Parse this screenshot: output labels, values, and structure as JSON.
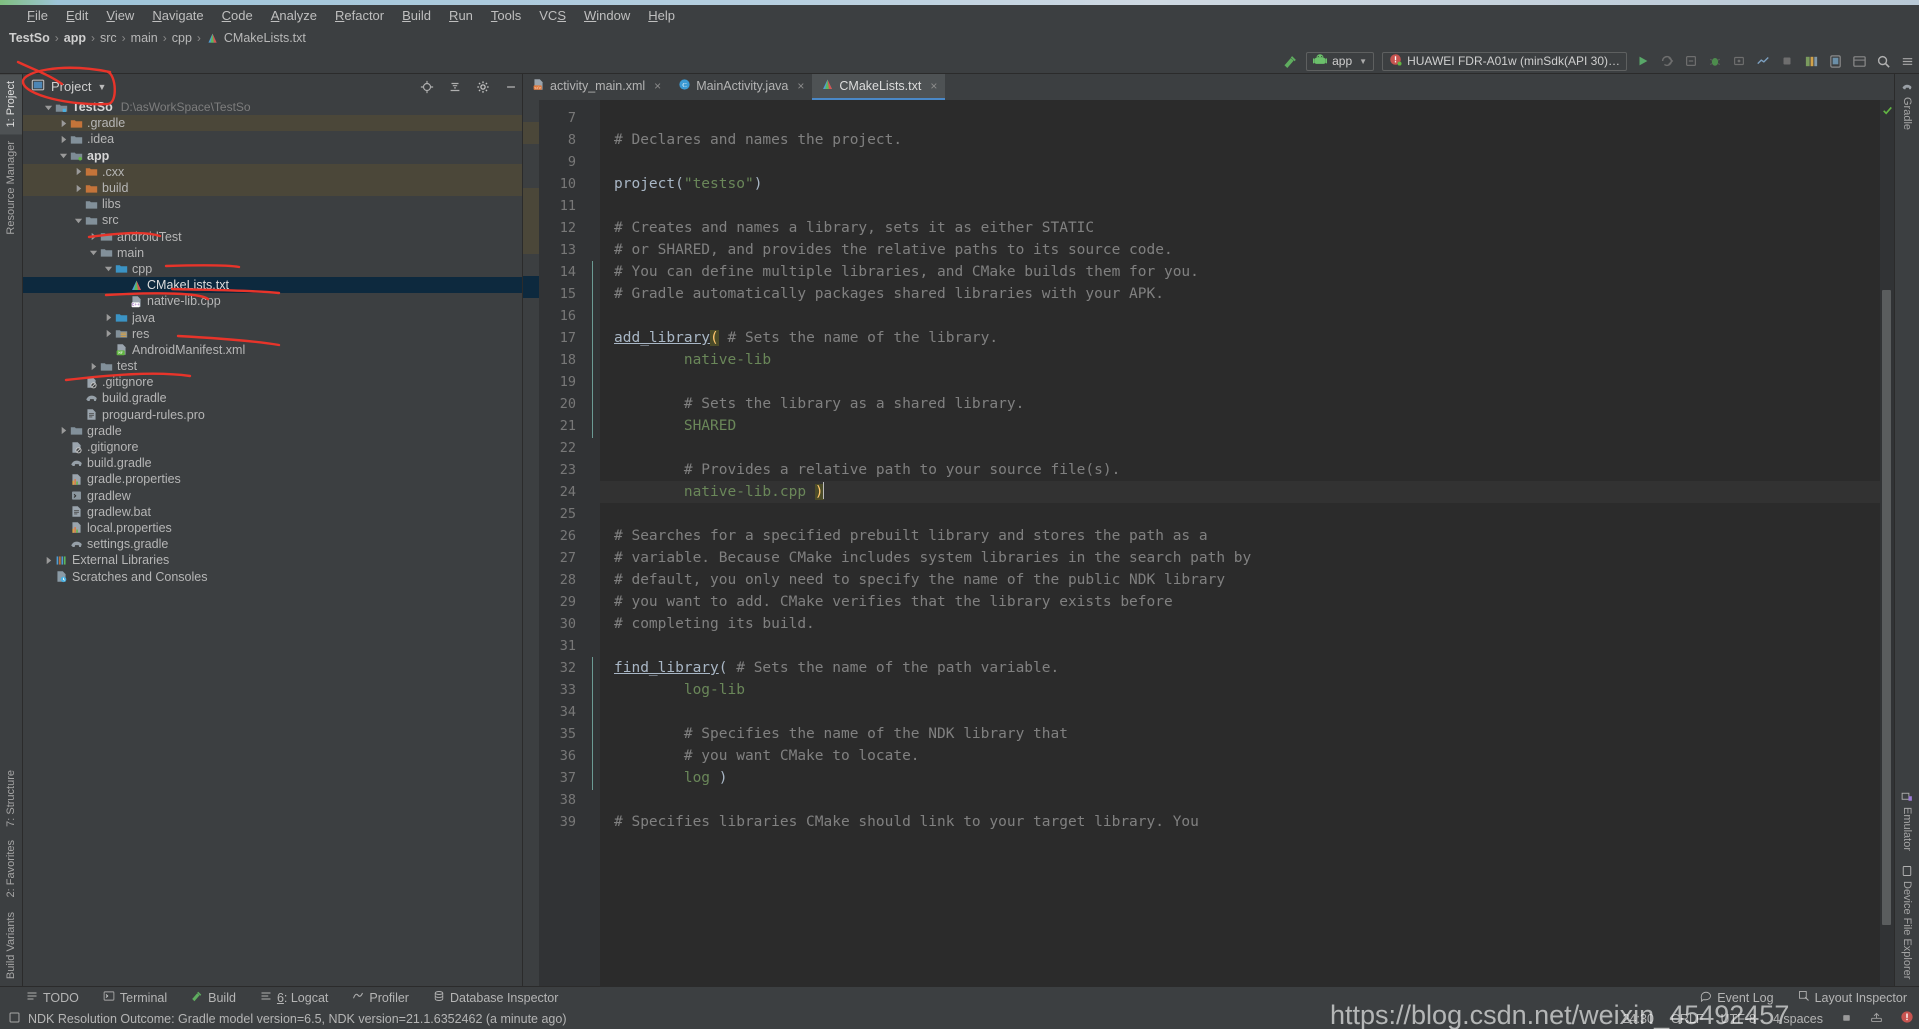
{
  "window": {
    "title": "TestSo"
  },
  "menubar": {
    "items": [
      {
        "label": "File",
        "mnemonic": "F"
      },
      {
        "label": "Edit",
        "mnemonic": "E"
      },
      {
        "label": "View",
        "mnemonic": "V"
      },
      {
        "label": "Navigate",
        "mnemonic": "N"
      },
      {
        "label": "Code",
        "mnemonic": "C"
      },
      {
        "label": "Analyze",
        "mnemonic": "A"
      },
      {
        "label": "Refactor",
        "mnemonic": "R"
      },
      {
        "label": "Build",
        "mnemonic": "B"
      },
      {
        "label": "Run",
        "mnemonic": "R"
      },
      {
        "label": "Tools",
        "mnemonic": "T"
      },
      {
        "label": "VCS",
        "mnemonic": "S"
      },
      {
        "label": "Window",
        "mnemonic": "W"
      },
      {
        "label": "Help",
        "mnemonic": "H"
      }
    ]
  },
  "breadcrumb": {
    "items": [
      "TestSo",
      "app",
      "src",
      "main",
      "cpp",
      "CMakeLists.txt"
    ],
    "separator": "›"
  },
  "toolbar": {
    "module_selector": "app",
    "device_selector": "HUAWEI FDR-A01w (minSdk(API 30)…",
    "run_tooltip": "Run",
    "icons": [
      "build-hammer-icon",
      "module-app-icon",
      "device-icon",
      "run-icon",
      "apply-changes-icon",
      "debug-icon",
      "attach-debugger-icon",
      "profiler-icon",
      "stop-icon",
      "avd-manager-icon",
      "sdk-manager-icon",
      "layout-inspector-icon",
      "search-icon",
      "more-icon"
    ]
  },
  "left_strip": {
    "top_items": [
      "1: Project",
      "Resource Manager"
    ],
    "bottom_items": [
      "7: Structure",
      "2: Favorites",
      "Build Variants"
    ],
    "selected": "1: Project"
  },
  "right_strip": {
    "top_items": [
      "Gradle"
    ],
    "bottom_items": [
      "Emulator",
      "Device File Explorer"
    ]
  },
  "project_panel": {
    "title": "Project",
    "header_icons": [
      "locate-icon",
      "collapse-all-icon",
      "settings-gear-icon",
      "minimize-icon"
    ],
    "tree": [
      {
        "depth": 0,
        "twist": "down",
        "icon": "module-root",
        "label": "TestSo",
        "path": "D:\\asWorkSpace\\TestSo",
        "bold": true,
        "alt": false,
        "selected": false
      },
      {
        "depth": 1,
        "twist": "right",
        "icon": "folder-orange",
        "label": ".gradle",
        "path": "",
        "bold": false,
        "alt": true,
        "selected": false
      },
      {
        "depth": 1,
        "twist": "right",
        "icon": "folder-grey",
        "label": ".idea",
        "path": "",
        "bold": false,
        "alt": false,
        "selected": false
      },
      {
        "depth": 1,
        "twist": "down",
        "icon": "module-app",
        "label": "app",
        "path": "",
        "bold": true,
        "alt": false,
        "selected": false
      },
      {
        "depth": 2,
        "twist": "right",
        "icon": "folder-orange",
        "label": ".cxx",
        "path": "",
        "bold": false,
        "alt": true,
        "selected": false
      },
      {
        "depth": 2,
        "twist": "right",
        "icon": "folder-orange",
        "label": "build",
        "path": "",
        "bold": false,
        "alt": true,
        "selected": false
      },
      {
        "depth": 2,
        "twist": "none",
        "icon": "folder-grey",
        "label": "libs",
        "path": "",
        "bold": false,
        "alt": false,
        "selected": false
      },
      {
        "depth": 2,
        "twist": "down",
        "icon": "folder-grey",
        "label": "src",
        "path": "",
        "bold": false,
        "alt": false,
        "selected": false
      },
      {
        "depth": 3,
        "twist": "right",
        "icon": "folder-grey",
        "label": "androidTest",
        "path": "",
        "bold": false,
        "alt": false,
        "selected": false
      },
      {
        "depth": 3,
        "twist": "down",
        "icon": "folder-grey",
        "label": "main",
        "path": "",
        "bold": false,
        "alt": false,
        "selected": false
      },
      {
        "depth": 4,
        "twist": "down",
        "icon": "folder-blue",
        "label": "cpp",
        "path": "",
        "bold": false,
        "alt": false,
        "selected": false
      },
      {
        "depth": 5,
        "twist": "none",
        "icon": "cmake-file",
        "label": "CMakeLists.txt",
        "path": "",
        "bold": false,
        "alt": false,
        "selected": true
      },
      {
        "depth": 5,
        "twist": "none",
        "icon": "cpp-file",
        "label": "native-lib.cpp",
        "path": "",
        "bold": false,
        "alt": false,
        "selected": false
      },
      {
        "depth": 4,
        "twist": "right",
        "icon": "folder-blue",
        "label": "java",
        "path": "",
        "bold": false,
        "alt": false,
        "selected": false
      },
      {
        "depth": 4,
        "twist": "right",
        "icon": "folder-res",
        "label": "res",
        "path": "",
        "bold": false,
        "alt": false,
        "selected": false
      },
      {
        "depth": 4,
        "twist": "none",
        "icon": "manifest-file",
        "label": "AndroidManifest.xml",
        "path": "",
        "bold": false,
        "alt": false,
        "selected": false
      },
      {
        "depth": 3,
        "twist": "right",
        "icon": "folder-grey",
        "label": "test",
        "path": "",
        "bold": false,
        "alt": false,
        "selected": false
      },
      {
        "depth": 2,
        "twist": "none",
        "icon": "gitignore-file",
        "label": ".gitignore",
        "path": "",
        "bold": false,
        "alt": false,
        "selected": false
      },
      {
        "depth": 2,
        "twist": "none",
        "icon": "gradle-file",
        "label": "build.gradle",
        "path": "",
        "bold": false,
        "alt": false,
        "selected": false
      },
      {
        "depth": 2,
        "twist": "none",
        "icon": "text-file",
        "label": "proguard-rules.pro",
        "path": "",
        "bold": false,
        "alt": false,
        "selected": false
      },
      {
        "depth": 1,
        "twist": "right",
        "icon": "folder-grey",
        "label": "gradle",
        "path": "",
        "bold": false,
        "alt": false,
        "selected": false
      },
      {
        "depth": 1,
        "twist": "none",
        "icon": "gitignore-file",
        "label": ".gitignore",
        "path": "",
        "bold": false,
        "alt": false,
        "selected": false
      },
      {
        "depth": 1,
        "twist": "none",
        "icon": "gradle-file",
        "label": "build.gradle",
        "path": "",
        "bold": false,
        "alt": false,
        "selected": false
      },
      {
        "depth": 1,
        "twist": "none",
        "icon": "properties-file",
        "label": "gradle.properties",
        "path": "",
        "bold": false,
        "alt": false,
        "selected": false
      },
      {
        "depth": 1,
        "twist": "none",
        "icon": "script-file",
        "label": "gradlew",
        "path": "",
        "bold": false,
        "alt": false,
        "selected": false
      },
      {
        "depth": 1,
        "twist": "none",
        "icon": "text-file",
        "label": "gradlew.bat",
        "path": "",
        "bold": false,
        "alt": false,
        "selected": false
      },
      {
        "depth": 1,
        "twist": "none",
        "icon": "properties-file",
        "label": "local.properties",
        "path": "",
        "bold": false,
        "alt": false,
        "selected": false
      },
      {
        "depth": 1,
        "twist": "none",
        "icon": "gradle-file",
        "label": "settings.gradle",
        "path": "",
        "bold": false,
        "alt": false,
        "selected": false
      },
      {
        "depth": 0,
        "twist": "right",
        "icon": "libraries-icon",
        "label": "External Libraries",
        "path": "",
        "bold": false,
        "alt": false,
        "selected": false
      },
      {
        "depth": 0,
        "twist": "none",
        "icon": "scratches-icon",
        "label": "Scratches and Consoles",
        "path": "",
        "bold": false,
        "alt": false,
        "selected": false
      }
    ]
  },
  "editor": {
    "tabs": [
      {
        "label": "activity_main.xml",
        "icon": "xml-layout-icon",
        "active": false,
        "closable": true
      },
      {
        "label": "MainActivity.java",
        "icon": "java-class-icon",
        "active": false,
        "closable": true
      },
      {
        "label": "CMakeLists.txt",
        "icon": "cmake-icon",
        "active": true,
        "closable": true
      }
    ],
    "first_line_number": 7,
    "lines": [
      {
        "n": 7,
        "tokens": []
      },
      {
        "n": 8,
        "tokens": [
          {
            "t": "# Declares and names the project.",
            "c": "cm"
          }
        ]
      },
      {
        "n": 9,
        "tokens": []
      },
      {
        "n": 10,
        "tokens": [
          {
            "t": "project(",
            "c": "par"
          },
          {
            "t": "\"testso\"",
            "c": "str"
          },
          {
            "t": ")",
            "c": "par"
          }
        ]
      },
      {
        "n": 11,
        "tokens": []
      },
      {
        "n": 12,
        "tokens": [
          {
            "t": "# Creates and names a library, sets it as either STATIC",
            "c": "cm"
          }
        ]
      },
      {
        "n": 13,
        "tokens": [
          {
            "t": "# or SHARED, and provides the relative paths to its source code.",
            "c": "cm"
          }
        ]
      },
      {
        "n": 14,
        "tokens": [
          {
            "t": "# You can define multiple libraries, and CMake builds them for you.",
            "c": "cm"
          }
        ]
      },
      {
        "n": 15,
        "tokens": [
          {
            "t": "# Gradle automatically packages shared libraries with your APK.",
            "c": "cm"
          }
        ]
      },
      {
        "n": 16,
        "tokens": []
      },
      {
        "n": 17,
        "tokens": [
          {
            "t": "add_library",
            "c": "kw"
          },
          {
            "t": "(",
            "c": "brk"
          },
          {
            "t": " # Sets the name of the library.",
            "c": "cm"
          }
        ]
      },
      {
        "n": 18,
        "tokens": [
          {
            "t": "        native-lib",
            "c": "grn"
          }
        ]
      },
      {
        "n": 19,
        "tokens": []
      },
      {
        "n": 20,
        "tokens": [
          {
            "t": "        # Sets the library as a shared library.",
            "c": "cm"
          }
        ]
      },
      {
        "n": 21,
        "tokens": [
          {
            "t": "        SHARED",
            "c": "grn"
          }
        ]
      },
      {
        "n": 22,
        "tokens": []
      },
      {
        "n": 23,
        "tokens": [
          {
            "t": "        # Provides a relative path to your source file(s).",
            "c": "cm"
          }
        ]
      },
      {
        "n": 24,
        "tokens": [
          {
            "t": "        native-lib.cpp ",
            "c": "grn"
          },
          {
            "t": ")",
            "c": "brk"
          }
        ],
        "current": true,
        "caret": true
      },
      {
        "n": 25,
        "tokens": []
      },
      {
        "n": 26,
        "tokens": [
          {
            "t": "# Searches for a specified prebuilt library and stores the path as a",
            "c": "cm"
          }
        ]
      },
      {
        "n": 27,
        "tokens": [
          {
            "t": "# variable. Because CMake includes system libraries in the search path by",
            "c": "cm"
          }
        ]
      },
      {
        "n": 28,
        "tokens": [
          {
            "t": "# default, you only need to specify the name of the public NDK library",
            "c": "cm"
          }
        ]
      },
      {
        "n": 29,
        "tokens": [
          {
            "t": "# you want to add. CMake verifies that the library exists before",
            "c": "cm"
          }
        ]
      },
      {
        "n": 30,
        "tokens": [
          {
            "t": "# completing its build.",
            "c": "cm"
          }
        ]
      },
      {
        "n": 31,
        "tokens": []
      },
      {
        "n": 32,
        "tokens": [
          {
            "t": "find_library",
            "c": "kw"
          },
          {
            "t": "(",
            "c": "par"
          },
          {
            "t": " # Sets the name of the path variable.",
            "c": "cm"
          }
        ]
      },
      {
        "n": 33,
        "tokens": [
          {
            "t": "        log-lib",
            "c": "grn"
          }
        ]
      },
      {
        "n": 34,
        "tokens": []
      },
      {
        "n": 35,
        "tokens": [
          {
            "t": "        # Specifies the name of the NDK library that",
            "c": "cm"
          }
        ]
      },
      {
        "n": 36,
        "tokens": [
          {
            "t": "        # you want CMake to locate.",
            "c": "cm"
          }
        ]
      },
      {
        "n": 37,
        "tokens": [
          {
            "t": "        log ",
            "c": "grn"
          },
          {
            "t": ")",
            "c": "par"
          }
        ]
      },
      {
        "n": 38,
        "tokens": []
      },
      {
        "n": 39,
        "tokens": [
          {
            "t": "# Specifies libraries CMake should link to your target library. You",
            "c": "cm"
          }
        ]
      }
    ]
  },
  "bottom_tools": [
    {
      "label": "TODO",
      "icon": "todo-icon",
      "mnemonic": ""
    },
    {
      "label": "Terminal",
      "icon": "terminal-icon",
      "mnemonic": ""
    },
    {
      "label": "Build",
      "icon": "build-hammer-icon",
      "mnemonic": ""
    },
    {
      "label": "6: Logcat",
      "icon": "logcat-icon",
      "mnemonic": "6"
    },
    {
      "label": "Profiler",
      "icon": "profiler-icon",
      "mnemonic": ""
    },
    {
      "label": "Database Inspector",
      "icon": "database-icon",
      "mnemonic": ""
    }
  ],
  "bottom_right_tools": [
    {
      "label": "Event Log",
      "icon": "event-log-icon"
    },
    {
      "label": "Layout Inspector",
      "icon": "layout-inspector-icon"
    }
  ],
  "statusbar": {
    "message": "NDK Resolution Outcome: Gradle model version=6.5, NDK version=21.1.6352462 (a minute ago)",
    "position": "24:30",
    "line_separator": "CRLF",
    "encoding": "UTF-8",
    "indent": "4 spaces",
    "icons": [
      "read-only-icon",
      "vcs-branch-icon",
      "notification-error-icon"
    ]
  },
  "watermark": "https://blog.csdn.net/weixin_45492457",
  "colors": {
    "bg_panel": "#3c3f41",
    "bg_editor": "#2b2b2b",
    "bg_gutter": "#313335",
    "selection_blue": "#0d293e",
    "row_alt": "#4b4739",
    "comment": "#808080",
    "string_green": "#6a8759",
    "text": "#a9b7c6",
    "accent_tab": "#4a88c7",
    "annotation_red": "#e8342a"
  }
}
